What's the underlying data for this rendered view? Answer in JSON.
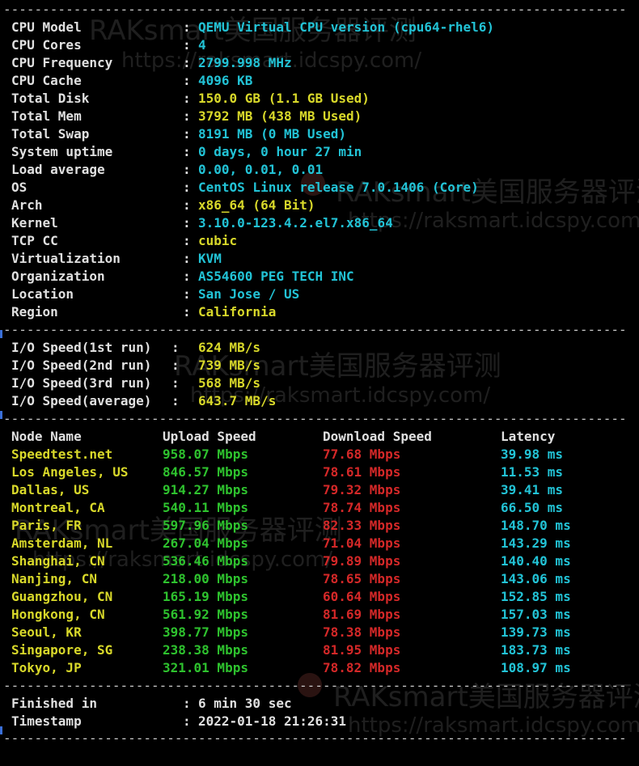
{
  "separator": "-------------------------------------------------------------------------------------------",
  "system_info": [
    {
      "label": "CPU Model",
      "value": "QEMU Virtual CPU version (cpu64-rhel6)",
      "color": "cyan"
    },
    {
      "label": "CPU Cores",
      "value": "4",
      "color": "cyan"
    },
    {
      "label": "CPU Frequency",
      "value": "2799.998 MHz",
      "color": "cyan"
    },
    {
      "label": "CPU Cache",
      "value": "4096 KB",
      "color": "cyan"
    },
    {
      "label": "Total Disk",
      "value": "150.0 GB (1.1 GB Used)",
      "color": "yellow"
    },
    {
      "label": "Total Mem",
      "value": "3792 MB (438 MB Used)",
      "color": "yellow"
    },
    {
      "label": "Total Swap",
      "value": "8191 MB (0 MB Used)",
      "color": "cyan"
    },
    {
      "label": "System uptime",
      "value": "0 days, 0 hour 27 min",
      "color": "cyan"
    },
    {
      "label": "Load average",
      "value": "0.00, 0.01, 0.01",
      "color": "cyan"
    },
    {
      "label": "OS",
      "value": "CentOS Linux release 7.0.1406 (Core)",
      "color": "cyan"
    },
    {
      "label": "Arch",
      "value": "x86_64 (64 Bit)",
      "color": "yellow"
    },
    {
      "label": "Kernel",
      "value": "3.10.0-123.4.2.el7.x86_64",
      "color": "cyan"
    },
    {
      "label": "TCP CC",
      "value": "cubic",
      "color": "yellow"
    },
    {
      "label": "Virtualization",
      "value": "KVM",
      "color": "cyan"
    },
    {
      "label": "Organization",
      "value": "AS54600 PEG TECH INC",
      "color": "cyan"
    },
    {
      "label": "Location",
      "value": "San Jose / US",
      "color": "cyan"
    },
    {
      "label": "Region",
      "value": "California",
      "color": "yellow"
    }
  ],
  "io_tests": [
    {
      "label": "I/O Speed(1st run)",
      "value": "624 MB/s"
    },
    {
      "label": "I/O Speed(2nd run)",
      "value": "739 MB/s"
    },
    {
      "label": "I/O Speed(3rd run)",
      "value": "568 MB/s"
    },
    {
      "label": "I/O Speed(average)",
      "value": "643.7 MB/s"
    }
  ],
  "speedtest": {
    "headers": {
      "node": "Node Name",
      "upload": "Upload Speed",
      "download": "Download Speed",
      "latency": "Latency"
    },
    "rows": [
      {
        "node": "Speedtest.net",
        "upload": "958.07 Mbps",
        "download": "77.68 Mbps",
        "latency": "39.98 ms"
      },
      {
        "node": "Los Angeles, US",
        "upload": "846.57 Mbps",
        "download": "78.61 Mbps",
        "latency": "11.53 ms"
      },
      {
        "node": "Dallas, US",
        "upload": "914.27 Mbps",
        "download": "79.32 Mbps",
        "latency": "39.41 ms"
      },
      {
        "node": "Montreal, CA",
        "upload": "540.11 Mbps",
        "download": "78.74 Mbps",
        "latency": "66.50 ms"
      },
      {
        "node": "Paris, FR",
        "upload": "597.96 Mbps",
        "download": "82.33 Mbps",
        "latency": "148.70 ms"
      },
      {
        "node": "Amsterdam, NL",
        "upload": "267.04 Mbps",
        "download": "71.04 Mbps",
        "latency": "143.29 ms"
      },
      {
        "node": "Shanghai, CN",
        "upload": "536.46 Mbps",
        "download": "79.89 Mbps",
        "latency": "140.40 ms"
      },
      {
        "node": "Nanjing, CN",
        "upload": "218.00 Mbps",
        "download": "78.65 Mbps",
        "latency": "143.06 ms"
      },
      {
        "node": "Guangzhou, CN",
        "upload": "165.19 Mbps",
        "download": "60.64 Mbps",
        "latency": "152.85 ms"
      },
      {
        "node": "Hongkong, CN",
        "upload": "561.92 Mbps",
        "download": "81.69 Mbps",
        "latency": "157.03 ms"
      },
      {
        "node": "Seoul, KR",
        "upload": "398.77 Mbps",
        "download": "78.38 Mbps",
        "latency": "139.73 ms"
      },
      {
        "node": "Singapore, SG",
        "upload": "238.38 Mbps",
        "download": "81.95 Mbps",
        "latency": "183.73 ms"
      },
      {
        "node": "Tokyo, JP",
        "upload": "321.01 Mbps",
        "download": "78.82 Mbps",
        "latency": "108.97 ms"
      }
    ]
  },
  "footer": [
    {
      "label": "Finished in",
      "value": "6 min 30 sec"
    },
    {
      "label": "Timestamp",
      "value": "2022-01-18 21:26:31"
    }
  ],
  "colon": ":",
  "watermark": {
    "brand": "RAKsmart美国服务器评测",
    "url": "https://raksmart.idcspy.com/"
  },
  "colors": {
    "background": "#000000",
    "label": "#e0e0e0",
    "cyan": "#22c3d6",
    "yellow": "#d8d82a",
    "green": "#2ec22e",
    "red": "#d42828",
    "separator": "#c8c8c8"
  }
}
